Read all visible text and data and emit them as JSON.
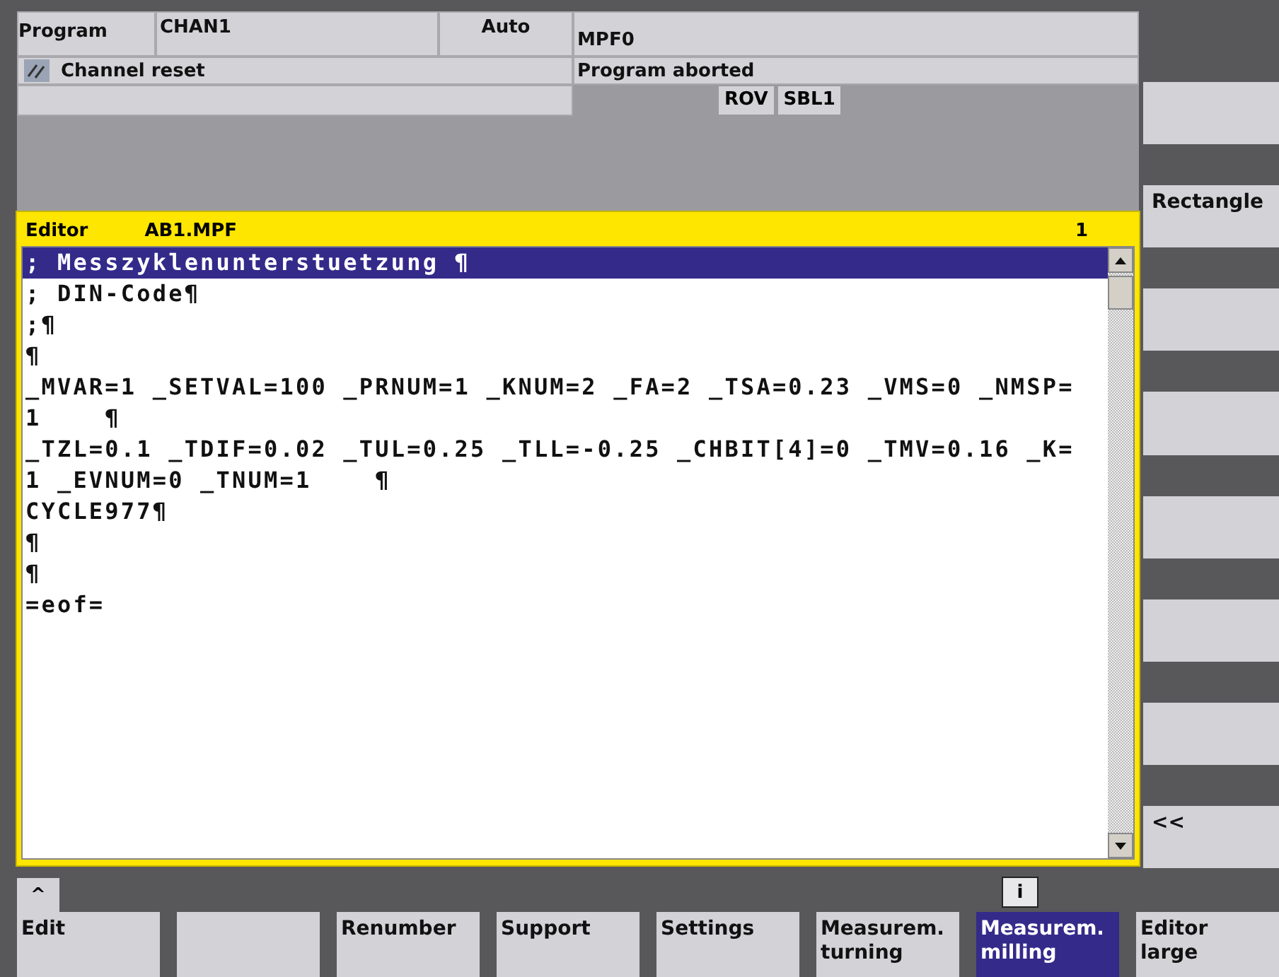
{
  "header": {
    "area": "Program",
    "channel": "CHAN1",
    "mode": "Auto",
    "program": "MPF0",
    "channel_status": "Channel reset",
    "program_status": "Program aborted",
    "indicators": [
      "ROV",
      "SBL1"
    ]
  },
  "editor": {
    "title": "Editor",
    "file": "AB1.MPF",
    "channel_number": "1",
    "lines": [
      {
        "text": "; Messzyklenunterstuetzung ¶",
        "selected": true
      },
      {
        "text": "; DIN-Code¶",
        "selected": false
      },
      {
        "text": ";¶",
        "selected": false
      },
      {
        "text": "¶",
        "selected": false
      },
      {
        "text": "_MVAR=1 _SETVAL=100 _PRNUM=1 _KNUM=2 _FA=2 _TSA=0.23 _VMS=0 _NMSP=",
        "selected": false
      },
      {
        "text": "1    ¶",
        "selected": false
      },
      {
        "text": "_TZL=0.1 _TDIF=0.02 _TUL=0.25 _TLL=-0.25 _CHBIT[4]=0 _TMV=0.16 _K=",
        "selected": false
      },
      {
        "text": "1 _EVNUM=0 _TNUM=1    ¶",
        "selected": false
      },
      {
        "text": "CYCLE977¶",
        "selected": false
      },
      {
        "text": "¶",
        "selected": false
      },
      {
        "text": "¶",
        "selected": false
      },
      {
        "text": "=eof=",
        "selected": false
      }
    ]
  },
  "recall_key": "^",
  "info_key": "i",
  "vertical_softkeys": [
    {
      "kind": "blank"
    },
    {
      "kind": "labeled",
      "label": "Rectangle"
    },
    {
      "kind": "blank"
    },
    {
      "kind": "blank"
    },
    {
      "kind": "blank"
    },
    {
      "kind": "blank"
    },
    {
      "kind": "blank"
    },
    {
      "kind": "labeled",
      "label": "<<"
    }
  ],
  "horizontal_softkeys": [
    {
      "label": "Edit",
      "selected": false
    },
    {
      "selected": false
    },
    {
      "label": "Renumber",
      "selected": false
    },
    {
      "label": "Support",
      "selected": false
    },
    {
      "label": "Settings",
      "selected": false
    },
    {
      "label": "Measurem.\nturning",
      "selected": false
    },
    {
      "label": "Measurem.\nmilling",
      "selected": true
    },
    {
      "label": "Editor\nlarge",
      "selected": false
    }
  ]
}
